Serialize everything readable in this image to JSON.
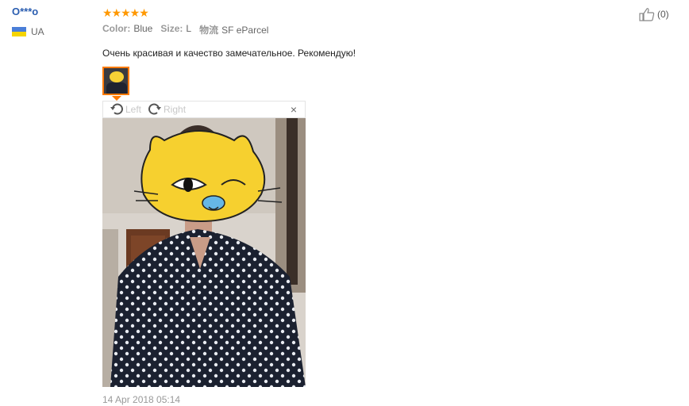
{
  "user": {
    "name": "O***o",
    "country": "UA"
  },
  "rating": {
    "stars": "★★★★★"
  },
  "meta": {
    "color_label": "Color:",
    "color_value": "Blue",
    "size_label": "Size:",
    "size_value": "L",
    "shipping_label": "物流",
    "shipping_value": "SF eParcel"
  },
  "review": {
    "text": "Очень красивая и качество замечательное. Рекомендую!"
  },
  "viewer": {
    "left_label": "Left",
    "right_label": "Right",
    "close_label": "×"
  },
  "date": "14 Apr 2018 05:14",
  "helpful": {
    "count": "(0)"
  }
}
